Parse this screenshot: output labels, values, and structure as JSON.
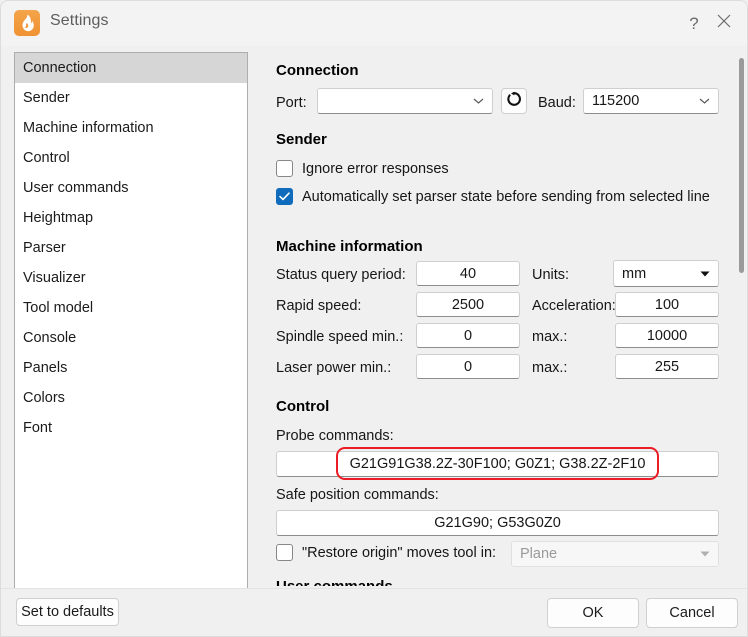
{
  "window": {
    "title": "Settings",
    "icon": "flame-app-icon",
    "help_label": "?",
    "close_label": "✕"
  },
  "sidebar": {
    "selected": "Connection",
    "items": [
      {
        "label": "Connection"
      },
      {
        "label": "Sender"
      },
      {
        "label": "Machine information"
      },
      {
        "label": "Control"
      },
      {
        "label": "User commands"
      },
      {
        "label": "Heightmap"
      },
      {
        "label": "Parser"
      },
      {
        "label": "Visualizer"
      },
      {
        "label": "Tool model"
      },
      {
        "label": "Console"
      },
      {
        "label": "Panels"
      },
      {
        "label": "Colors"
      },
      {
        "label": "Font"
      }
    ]
  },
  "sections": {
    "connection": {
      "title": "Connection",
      "port_label": "Port:",
      "port_value": "",
      "refresh_icon": "refresh-icon",
      "baud_label": "Baud:",
      "baud_value": "115200"
    },
    "sender": {
      "title": "Sender",
      "ignore_errors_label": "Ignore error responses",
      "ignore_errors_checked": false,
      "auto_parser_label": "Automatically set parser state before sending from selected line",
      "auto_parser_checked": true
    },
    "machine": {
      "title": "Machine information",
      "status_query_label": "Status query period:",
      "status_query_value": "40",
      "units_label": "Units:",
      "units_value": "mm",
      "rapid_speed_label": "Rapid speed:",
      "rapid_speed_value": "2500",
      "acceleration_label": "Acceleration:",
      "acceleration_value": "100",
      "spindle_min_label": "Spindle speed min.:",
      "spindle_min_value": "0",
      "spindle_max_label": "max.:",
      "spindle_max_value": "10000",
      "laser_min_label": "Laser power min.:",
      "laser_min_value": "0",
      "laser_max_label": "max.:",
      "laser_max_value": "255"
    },
    "control": {
      "title": "Control",
      "probe_label": "Probe commands:",
      "probe_value": "G21G91G38.2Z-30F100; G0Z1; G38.2Z-2F10",
      "probe_highlight_color": "#ec1c24",
      "safe_label": "Safe position commands:",
      "safe_value": "G21G90; G53G0Z0",
      "restore_origin_label": "\"Restore origin\" moves tool in:",
      "restore_origin_checked": false,
      "restore_origin_value": "Plane"
    },
    "user_commands": {
      "title": "User commands"
    }
  },
  "footer": {
    "set_defaults": "Set to defaults",
    "ok": "OK",
    "cancel": "Cancel"
  }
}
